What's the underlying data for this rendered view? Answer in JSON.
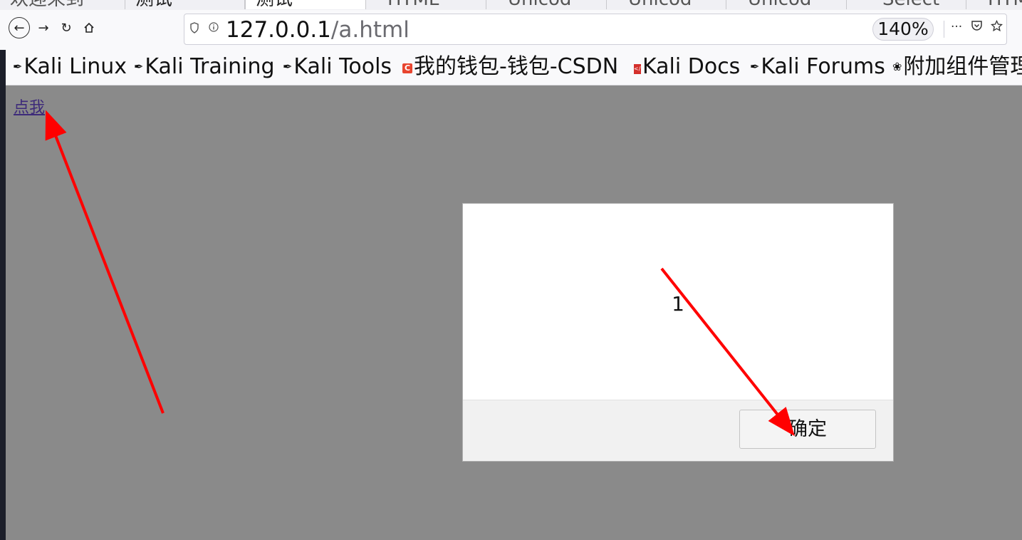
{
  "tabs": [
    {
      "label": "欢迎来到"
    },
    {
      "label": "测试"
    },
    {
      "label": "测试"
    },
    {
      "label": "HTML"
    },
    {
      "label": "Unicod"
    },
    {
      "label": "Unicod"
    },
    {
      "label": "Unicod"
    },
    {
      "label": "Select"
    },
    {
      "label": "HTML"
    }
  ],
  "toolbar": {
    "url_host": "127.0.0.1",
    "url_path": "/a.html",
    "zoom": "140%",
    "more_label": "···"
  },
  "bookmarks": [
    {
      "label": "Kali Linux",
      "icon": "kali-dragon-icon"
    },
    {
      "label": "Kali Training",
      "icon": "kali-dragon-icon"
    },
    {
      "label": "Kali Tools",
      "icon": "kali-dragon-icon"
    },
    {
      "label": "我的钱包-钱包-CSDN",
      "icon": "csdn-icon",
      "icon_glyph": "C"
    },
    {
      "label": "Kali Docs",
      "icon": "kali-docs-icon"
    },
    {
      "label": "Kali Forums",
      "icon": "kali-dragon-icon"
    },
    {
      "label": "附加组件管理",
      "icon": "puzzle-icon"
    }
  ],
  "page": {
    "link_text": "点我"
  },
  "dialog": {
    "message": "1",
    "ok_label": "确定"
  },
  "colors": {
    "overlay": "#8a8a8a",
    "link": "#3d2a7a",
    "annotation_arrow": "#ff0000"
  }
}
